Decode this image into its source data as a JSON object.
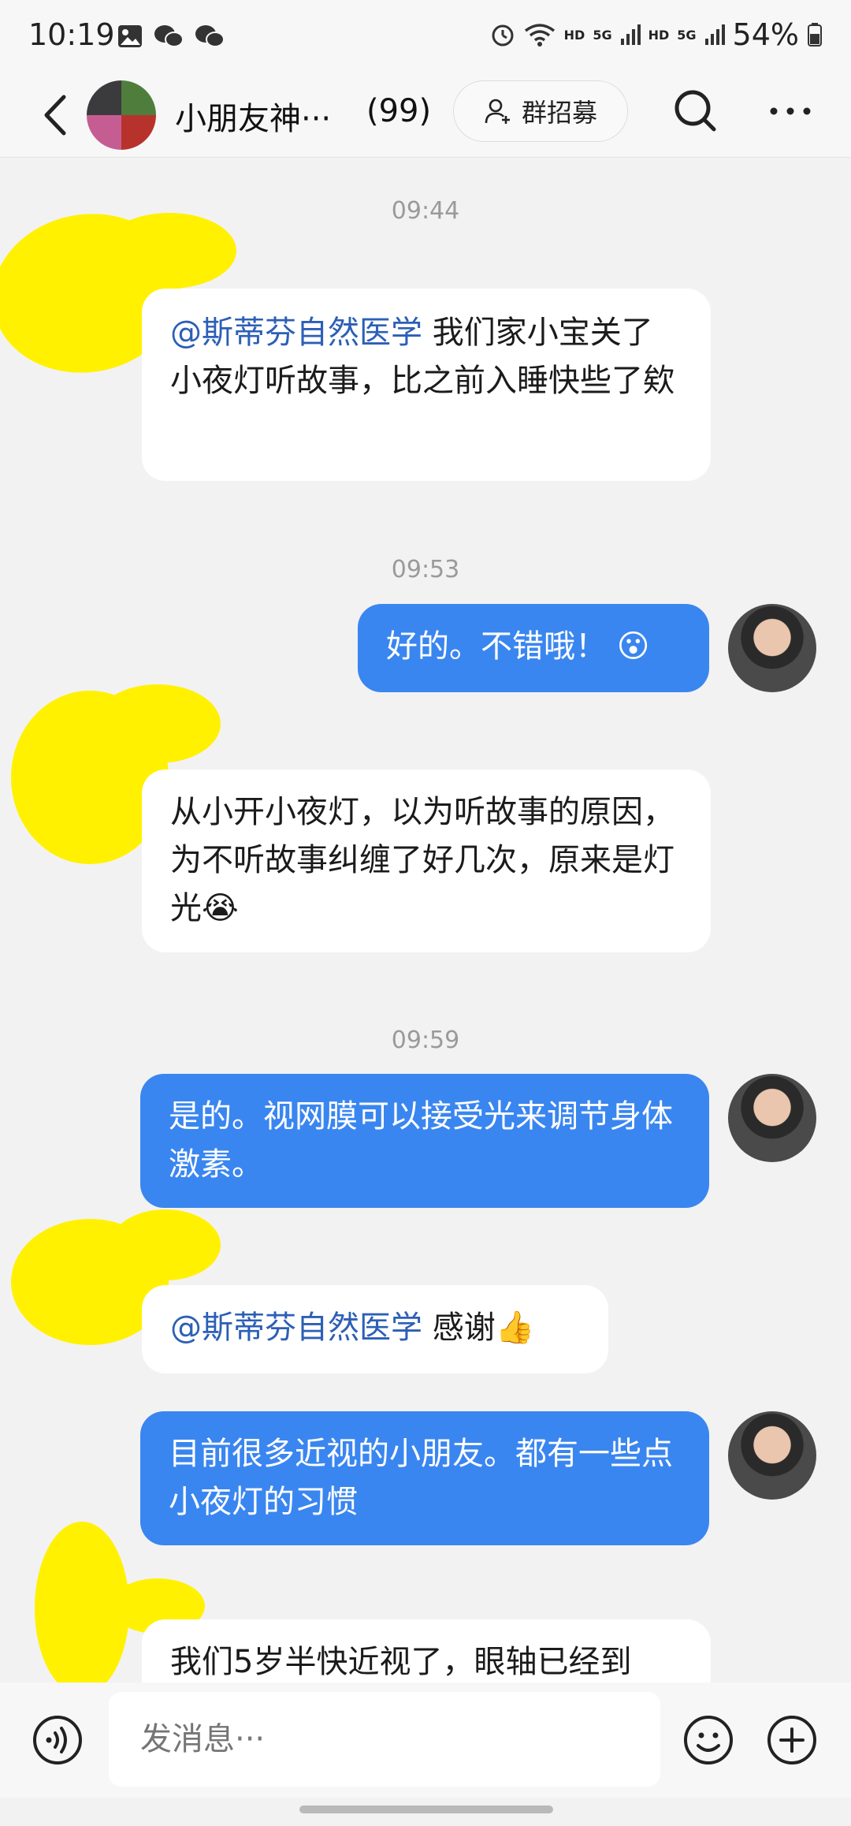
{
  "status_bar": {
    "time": "10:19",
    "network_left": "HD",
    "signal_label_1": "5G",
    "network_right": "HD",
    "signal_label_2": "5G",
    "battery": "54%"
  },
  "nav": {
    "title": "小朋友神···",
    "member_count": "(99)",
    "recruit_label": "群招募"
  },
  "messages": [
    {
      "type": "timestamp",
      "text": "09:44"
    },
    {
      "type": "incoming",
      "mention": "@斯蒂芬自然医学",
      "text": "我们家小宝关了小夜灯听故事，比之前入睡快些了欸"
    },
    {
      "type": "timestamp",
      "text": "09:53"
    },
    {
      "type": "outgoing",
      "text": "好的。不错哦！"
    },
    {
      "type": "incoming",
      "text": "从小开小夜灯，以为听故事的原因，为不听故事纠缠了好几次，原来是灯光"
    },
    {
      "type": "timestamp",
      "text": "09:59"
    },
    {
      "type": "outgoing",
      "text": "是的。视网膜可以接受光来调节身体激素。"
    },
    {
      "type": "incoming",
      "mention": "@斯蒂芬自然医学",
      "text": "感谢"
    },
    {
      "type": "outgoing",
      "text": "目前很多近视的小朋友。都有一些点小夜灯的习惯"
    },
    {
      "type": "incoming",
      "text": "我们5岁半快近视了，眼轴已经到"
    }
  ],
  "input": {
    "placeholder": "发消息···"
  },
  "icons": {
    "back": "back-arrow-icon",
    "search": "search-icon",
    "more": "more-dots-icon",
    "voice": "voice-icon",
    "emoji": "emoji-icon",
    "plus": "plus-icon",
    "add_person": "add-person-icon"
  },
  "colors": {
    "outgoing_bubble": "#3a86f0",
    "incoming_bubble": "#ffffff",
    "mention": "#2c5fb6",
    "background": "#f2f2f3",
    "highlight": "#fff100"
  }
}
